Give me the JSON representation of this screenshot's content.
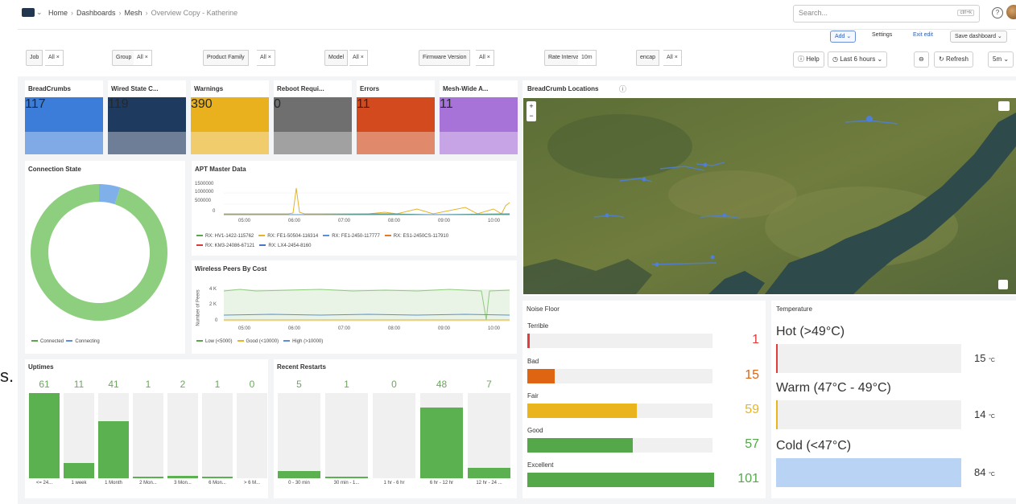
{
  "breadcrumb": {
    "home": "Home",
    "dashboards": "Dashboards",
    "mesh": "Mesh",
    "current": "Overview Copy - Katherine",
    "sep": "›"
  },
  "topbar": {
    "search_placeholder": "Search...",
    "search_shortcut": "ctrl+k",
    "add_label": "Add",
    "settings_label": "Settings",
    "exit_edit_label": "Exit edit",
    "save_label": "Save dashboard"
  },
  "variables": [
    {
      "label": "Job",
      "value": "All ×"
    },
    {
      "label": "Group",
      "value": "All ×"
    },
    {
      "label": "Product Family",
      "value": "All ×"
    },
    {
      "label": "Model",
      "value": "All ×"
    },
    {
      "label": "Firmware Version",
      "value": "All ×"
    },
    {
      "label": "Rate Interval",
      "value": "10m"
    },
    {
      "label": "encap",
      "value": "All ×"
    }
  ],
  "controls": {
    "help": "Help",
    "time_range": "Last 6 hours",
    "refresh": "Refresh",
    "refresh_interval": "5m"
  },
  "stats": [
    {
      "title": "BreadCrumbs",
      "value": "117",
      "color": "#3b7dd8"
    },
    {
      "title": "Wired State C...",
      "value": "119",
      "color": "#1f3a5f"
    },
    {
      "title": "Warnings",
      "value": "390",
      "color": "#e9b11e"
    },
    {
      "title": "Reboot Requi...",
      "value": "0",
      "color": "#6f6f6f"
    },
    {
      "title": "Errors",
      "value": "11",
      "color": "#d24a1d"
    },
    {
      "title": "Mesh-Wide A...",
      "value": "11",
      "color": "#a873d8"
    }
  ],
  "connection_state": {
    "title": "Connection State",
    "legend": [
      "Connected",
      "Connecting"
    ],
    "colors": [
      "#8ecf7f",
      "#7fb0ea"
    ],
    "chart_data": {
      "type": "pie",
      "labels": [
        "Connected",
        "Connecting"
      ],
      "values": [
        95,
        5
      ]
    }
  },
  "apt_master": {
    "title": "APT Master Data",
    "yticks": [
      "1500000",
      "1000000",
      "500000",
      "0"
    ],
    "xticks": [
      "05:00",
      "06:00",
      "07:00",
      "08:00",
      "09:00",
      "10:00"
    ],
    "legend": [
      {
        "name": "RX: HV1-1422-115762",
        "color": "#5aa54d"
      },
      {
        "name": "RX: FE1-50504-116314",
        "color": "#e5b42b"
      },
      {
        "name": "RX: FE1-2450-117777",
        "color": "#5b8fd8"
      },
      {
        "name": "RX: ES1-2450CS-117910",
        "color": "#e07b2d"
      },
      {
        "name": "RX: KM3-24086-67121",
        "color": "#d63b3b"
      },
      {
        "name": "RX: LX4-2454-8160",
        "color": "#4a74c6"
      }
    ]
  },
  "wireless_peers": {
    "title": "Wireless Peers By Cost",
    "ylabel": "Number of Peers",
    "yticks": [
      "4 K",
      "2 K",
      "0"
    ],
    "xticks": [
      "05:00",
      "06:00",
      "07:00",
      "08:00",
      "09:00",
      "10:00"
    ],
    "legend": [
      {
        "name": "Low (<5000)",
        "color": "#5aa54d"
      },
      {
        "name": "Good (<10000)",
        "color": "#e5b42b"
      },
      {
        "name": "High (>10000)",
        "color": "#5b8fd8"
      }
    ]
  },
  "uptimes": {
    "title": "Uptimes",
    "chart_data": {
      "type": "bar",
      "categories": [
        "<= 24...",
        "1 week",
        "1 Month",
        "2 Mon...",
        "3 Mon...",
        "6 Mon...",
        "> 6 M..."
      ],
      "values": [
        61,
        11,
        41,
        1,
        2,
        1,
        0
      ]
    }
  },
  "recent_restarts": {
    "title": "Recent Restarts",
    "chart_data": {
      "type": "bar",
      "categories": [
        "0 - 30 min",
        "30 min - 1...",
        "1 hr - 6 hr",
        "6 hr - 12 hr",
        "12 hr - 24 ..."
      ],
      "values": [
        5,
        1,
        0,
        48,
        7
      ]
    }
  },
  "map": {
    "title": "BreadCrumb Locations",
    "zoom_in": "+",
    "zoom_out": "−"
  },
  "noise_floor": {
    "title": "Noise Floor",
    "items": [
      {
        "label": "Terrible",
        "value": 1,
        "color": "#e23c3c"
      },
      {
        "label": "Bad",
        "value": 15,
        "color": "#e06512"
      },
      {
        "label": "Fair",
        "value": 59,
        "color": "#eab51c"
      },
      {
        "label": "Good",
        "value": 57,
        "color": "#55a84a"
      },
      {
        "label": "Excellent",
        "value": 101,
        "color": "#55a84a"
      }
    ]
  },
  "temperature": {
    "title": "Temperature",
    "unit": "°C",
    "items": [
      {
        "label": "Hot (>49°C)",
        "value": "15",
        "color": "#e23c3c",
        "fill": 0.01
      },
      {
        "label": "Warm (47°C - 49°C)",
        "value": "14",
        "color": "#eab51c",
        "fill": 0.01
      },
      {
        "label": "Cold (<47°C)",
        "value": "84",
        "color": "#b9d3f5",
        "fill": 1.0
      }
    ]
  },
  "left_edge_text": "s."
}
